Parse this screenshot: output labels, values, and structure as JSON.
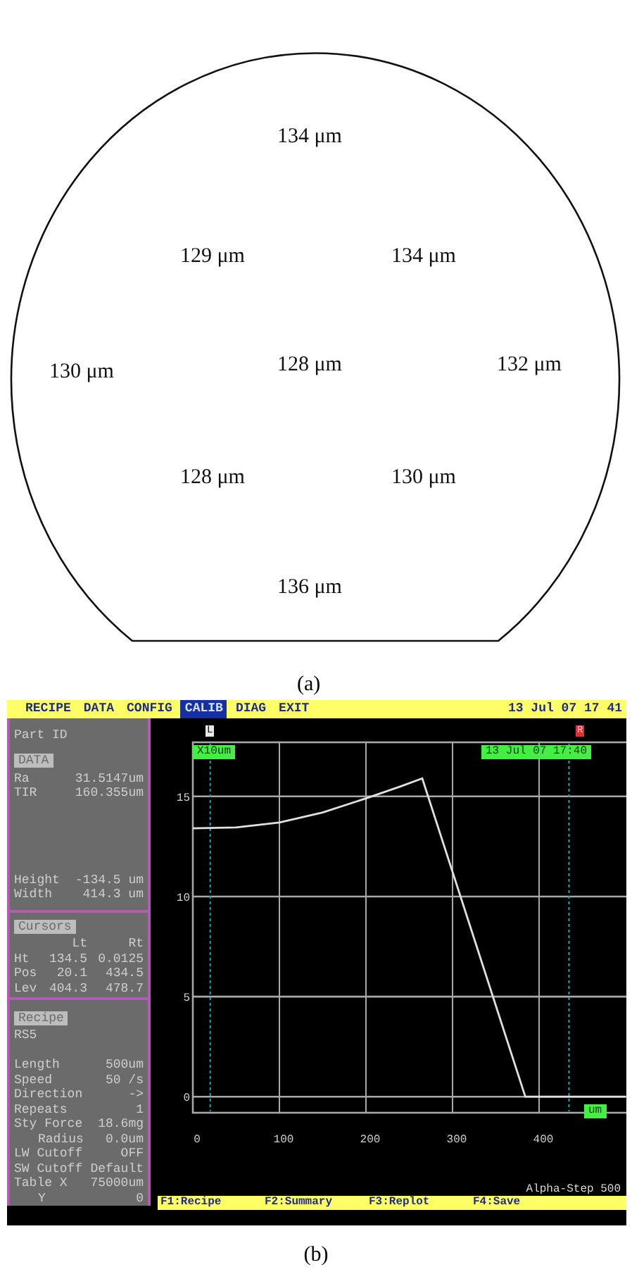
{
  "figure_a": {
    "labels": [
      "134 μm",
      "129 μm",
      "134 μm",
      "130 μm",
      "128 μm",
      "132 μm",
      "128 μm",
      "130 μm",
      "136 μm"
    ],
    "caption": "(a)"
  },
  "screen": {
    "menu": [
      {
        "label": "RECIPE",
        "selected": false
      },
      {
        "label": "DATA",
        "selected": false
      },
      {
        "label": "CONFIG",
        "selected": false
      },
      {
        "label": "CALIB",
        "selected": true
      },
      {
        "label": "DIAG",
        "selected": false
      },
      {
        "label": "EXIT",
        "selected": false
      }
    ],
    "clock": "13 Jul 07 17 41",
    "left_panel": {
      "part_id": "Part ID",
      "data": {
        "title": "DATA",
        "top_rows": [
          {
            "label": "Ra",
            "value": "31.5147um"
          },
          {
            "label": "TIR",
            "value": "160.355um"
          }
        ],
        "bottom_rows": [
          {
            "label": "Height",
            "value": "-134.5 um"
          },
          {
            "label": "Width",
            "value": "414.3 um"
          }
        ]
      },
      "cursors": {
        "title": "Cursors",
        "columns": [
          "Lt",
          "Rt"
        ],
        "rows": [
          {
            "label": "Ht",
            "lt": "134.5",
            "rt": "0.0125"
          },
          {
            "label": "Pos",
            "lt": "20.1",
            "rt": "434.5"
          },
          {
            "label": "Lev",
            "lt": "404.3",
            "rt": "478.7"
          }
        ]
      },
      "recipe": {
        "title": "Recipe",
        "name": "RS5",
        "rows": [
          {
            "label": "Length",
            "value": "500um"
          },
          {
            "label": "Speed",
            "value": "50 /s"
          },
          {
            "label": "Direction",
            "value": "->"
          },
          {
            "label": "Repeats",
            "value": "1"
          },
          {
            "label": "Sty Force",
            "value": "18.6mg",
            "children": [
              {
                "label": "Radius",
                "value": "0.0um"
              }
            ]
          },
          {
            "label": "LW Cutoff",
            "value": "OFF"
          },
          {
            "label": "SW Cutoff",
            "value": "Default"
          },
          {
            "label": "Table X",
            "value": "75000um",
            "children": [
              {
                "label": "Y",
                "value": "0"
              }
            ]
          }
        ]
      }
    },
    "plot": {
      "cursor_markers": [
        "L",
        "R"
      ],
      "scale_badge": "X10um",
      "timestamp_badge": "13 Jul 07 17:40",
      "unit_badge": "um",
      "instrument": "Alpha-Step 500",
      "chart_data": {
        "type": "line",
        "x": [
          0,
          50,
          100,
          150,
          200,
          240,
          265,
          384,
          500
        ],
        "series": [
          {
            "color": "#e0e0e0",
            "values": [
              13.4,
              13.45,
              13.7,
              14.2,
              14.9,
              15.5,
              15.9,
              0,
              0
            ]
          }
        ],
        "xlim": [
          0,
          500
        ],
        "ylim": [
          -0.8,
          17.7
        ],
        "xticks": [
          0,
          100,
          200,
          300,
          400
        ],
        "yticks": [
          0,
          5,
          10,
          15
        ],
        "grid": true,
        "ref_lines": [
          {
            "axis": "x",
            "value": 20.1
          },
          {
            "axis": "x",
            "value": 434.5
          }
        ]
      }
    },
    "function_keys": [
      "F1:Recipe",
      "F2:Summary",
      "F3:Replot",
      "F4:Save"
    ]
  },
  "caption_b": "(b)"
}
